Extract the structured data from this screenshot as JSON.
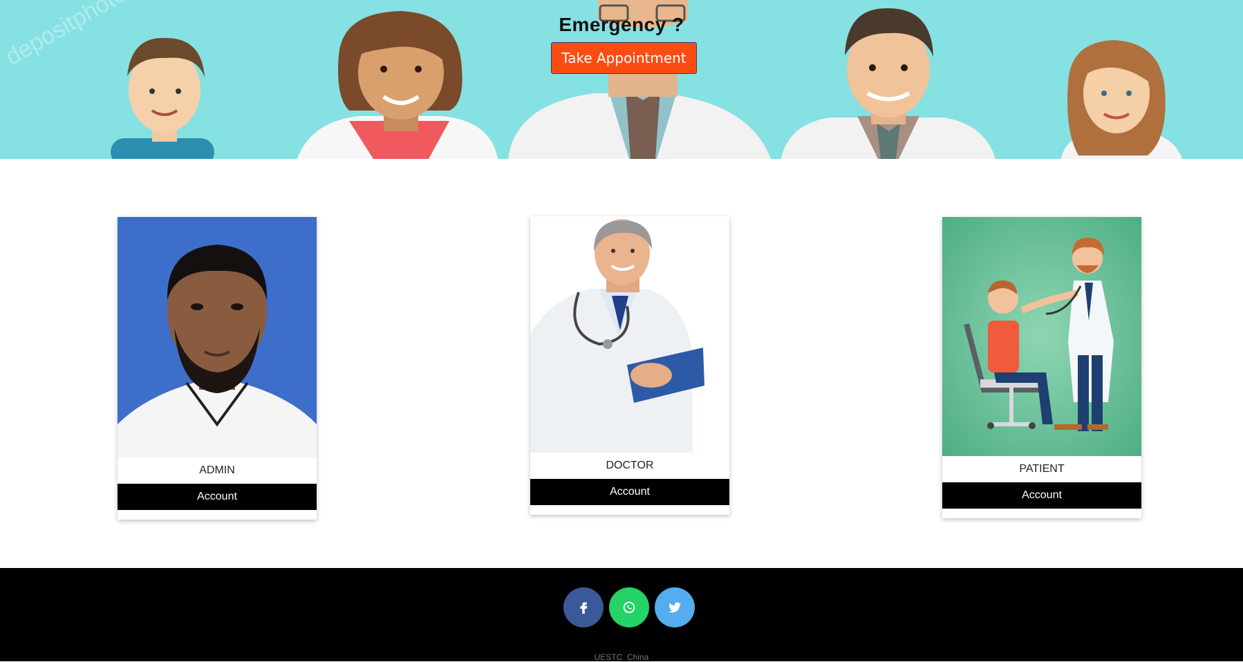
{
  "hero": {
    "title": "Emergency ?",
    "button_label": "Take Appointment",
    "watermark": "depositphotos"
  },
  "cards": [
    {
      "label": "ADMIN",
      "button_label": "Account",
      "photo": "admin-portrait"
    },
    {
      "label": "DOCTOR",
      "button_label": "Account",
      "photo": "doctor-portrait"
    },
    {
      "label": "PATIENT",
      "button_label": "Account",
      "photo": "doctor-examining-patient-illustration"
    }
  ],
  "footer": {
    "social": [
      {
        "name": "facebook-icon",
        "color": "#3b5998"
      },
      {
        "name": "whatsapp-icon",
        "color": "#25d366"
      },
      {
        "name": "twitter-icon",
        "color": "#55acee"
      }
    ],
    "copyright": "UESTC_China"
  },
  "colors": {
    "hero_bg": "#86e1e3",
    "appointment_button": "#fb4d12",
    "account_button": "#000000",
    "footer_bg": "#000000"
  }
}
